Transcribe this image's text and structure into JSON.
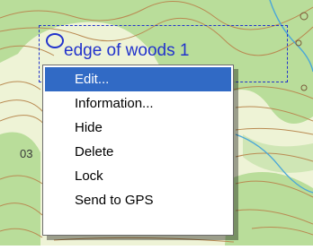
{
  "map": {
    "waypoint_label": "edge of woods 1",
    "elevation_label": "03",
    "colors": {
      "terrain_green": "#b9dd9a",
      "terrain_light": "#eef3d6",
      "contour_brown": "#b98a52",
      "stream_blue": "#4aa7d8",
      "selection_blue": "#2233cc"
    }
  },
  "context_menu": {
    "items": [
      {
        "label": "Edit...",
        "selected": true
      },
      {
        "label": "Information...",
        "selected": false
      },
      {
        "label": "Hide",
        "selected": false
      },
      {
        "label": "Delete",
        "selected": false
      },
      {
        "label": "Lock",
        "selected": false
      },
      {
        "label": "Send to GPS",
        "selected": false
      }
    ],
    "highlight_color": "#316ac5"
  }
}
